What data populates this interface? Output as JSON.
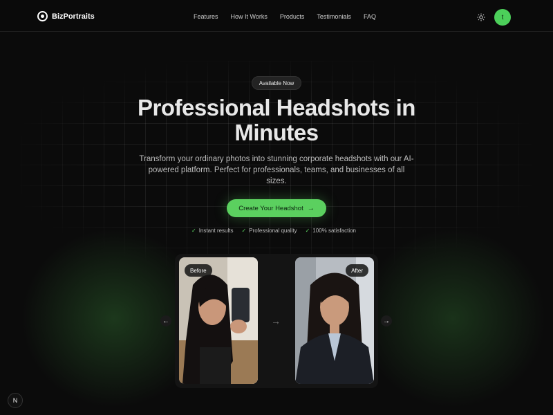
{
  "nav": {
    "brand": "BizPortraits",
    "links": [
      "Features",
      "How It Works",
      "Products",
      "Testimonials",
      "FAQ"
    ],
    "avatar_initial": "t"
  },
  "hero": {
    "badge": "Available Now",
    "title": "Professional Headshots in Minutes",
    "subtitle": "Transform your ordinary photos into stunning corporate headshots with our AI-powered platform. Perfect for professionals, teams, and businesses of all sizes.",
    "cta": "Create Your Headshot",
    "features": [
      "Instant results",
      "Professional quality",
      "100% satisfaction"
    ]
  },
  "comparison": {
    "before_label": "Before",
    "after_label": "After"
  },
  "dev_badge": "N",
  "colors": {
    "accent": "#5bd05f",
    "background": "#0b0b0b"
  },
  "icons": {
    "theme": "sun-icon",
    "cta_arrow": "arrow-right-icon",
    "check": "check-icon"
  }
}
